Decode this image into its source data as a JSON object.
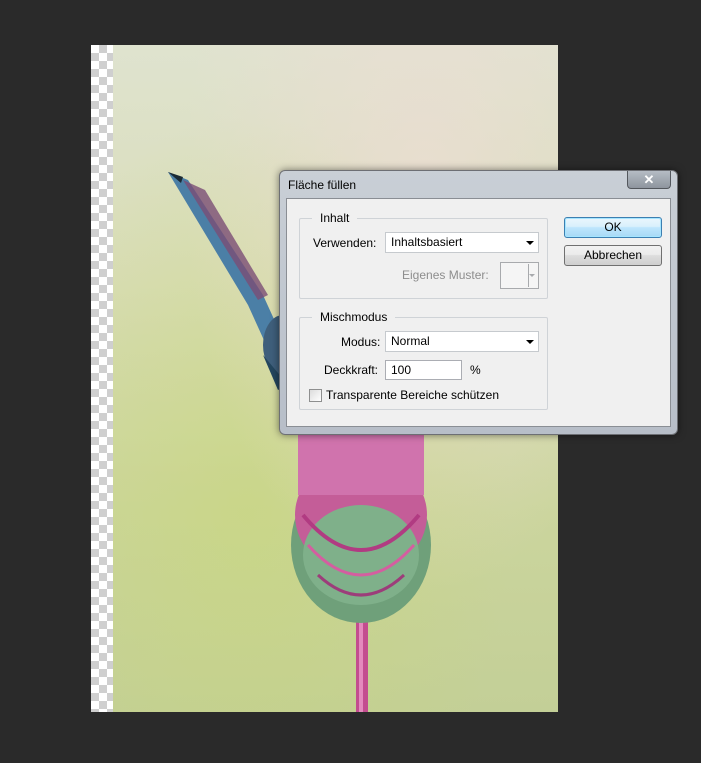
{
  "dialog": {
    "title": "Fläche füllen",
    "close_glyph": "✕",
    "content_group": {
      "legend": "Inhalt",
      "use_label": "Verwenden:",
      "use_value": "Inhaltsbasiert",
      "pattern_label": "Eigenes Muster:"
    },
    "blend_group": {
      "legend": "Mischmodus",
      "mode_label": "Modus:",
      "mode_value": "Normal",
      "opacity_label": "Deckkraft:",
      "opacity_value": "100",
      "opacity_unit": "%",
      "preserve_transparency_label": "Transparente Bereiche schützen",
      "preserve_transparency_checked": false
    },
    "ok_label": "OK",
    "cancel_label": "Abbrechen"
  },
  "colors": {
    "workspace_bg": "#2a2a2a",
    "dialog_face": "#f0f0f0",
    "default_button_accent": "#3c7fb1"
  }
}
